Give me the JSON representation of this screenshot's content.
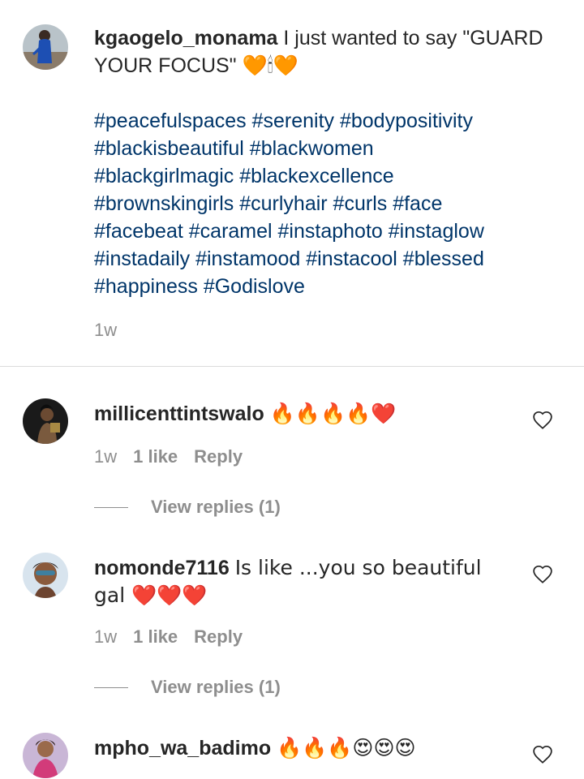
{
  "caption": {
    "username": "kgaogelo_monama",
    "text": "I just wanted to say \"GUARD YOUR FOCUS\" 🧡🕯🧡",
    "hashtags": "#peacefulspaces #serenity #bodypositivity\n#blackisbeautiful #blackwomen\n#blackgirlmagic #blackexcellence\n#brownskingirls #curlyhair #curls #face\n#facebeat #caramel #instaphoto #instaglow\n#instadaily #instamood #instacool #blessed\n#happiness #Godislove",
    "time": "1w"
  },
  "comments": [
    {
      "username": "millicenttintswalo",
      "text": "🔥🔥🔥🔥❤️",
      "time": "1w",
      "likes": "1 like",
      "reply": "Reply",
      "view_replies": "View replies (1)"
    },
    {
      "username": "nomonde7116",
      "text": "Is like ...you so beautiful gal ❤️❤️❤️",
      "time": "1w",
      "likes": "1 like",
      "reply": "Reply",
      "view_replies": "View replies (1)"
    },
    {
      "username": "mpho_wa_badimo",
      "text": "🔥🔥🔥😍😍😍"
    }
  ],
  "colors": {
    "hashtag": "#003569",
    "meta": "#8e8e8e",
    "text": "#262626",
    "divider": "#dbdbdb"
  },
  "icons": {
    "like": "heart-outline-icon"
  }
}
